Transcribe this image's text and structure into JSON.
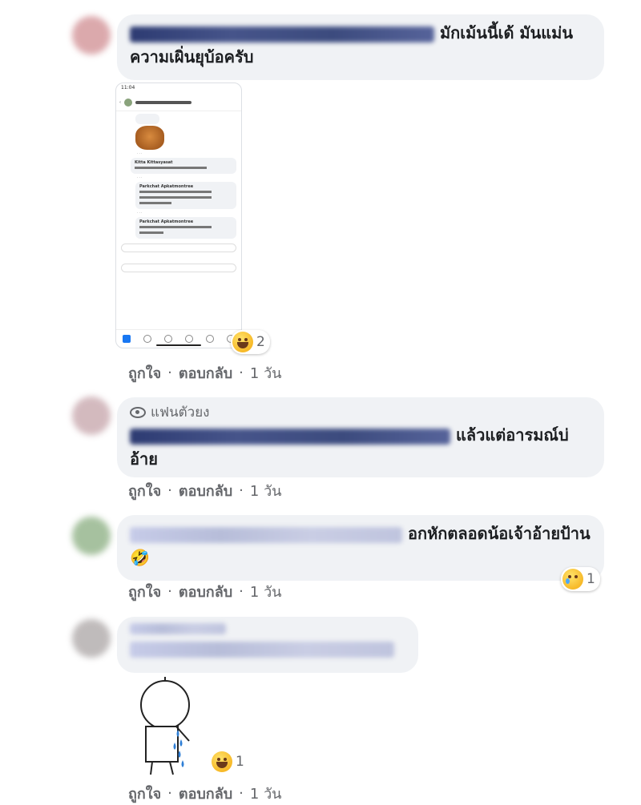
{
  "comments": [
    {
      "id": "c1",
      "suffix": "มักเม้นนี้เด้ มันแม่นความเผิ่นยุบ้อครับ",
      "meta": {
        "like": "ถูกใจ",
        "reply": "ตอบกลับ",
        "time": "1 วัน"
      },
      "reaction": {
        "emoji": "laugh",
        "count": "2"
      },
      "attachment": {
        "type": "phone-screenshot",
        "status_time": "11:04",
        "replies": [
          "Kitta Kittasyasat",
          "Parkchat Apkatmontree",
          "Parkchat Apkatmontree"
        ]
      }
    },
    {
      "id": "c2",
      "badge": "แฟนตัวยง",
      "suffix": "แล้วแต่อารมณ์บ่อ้าย",
      "meta": {
        "like": "ถูกใจ",
        "reply": "ตอบกลับ",
        "time": "1 วัน"
      }
    },
    {
      "id": "c3",
      "suffix": "อกหักตลอดน้อเจ้าอ้ายป้าน🤣",
      "meta": {
        "like": "ถูกใจ",
        "reply": "ตอบกลับ",
        "time": "1 วัน"
      },
      "reaction": {
        "emoji": "sad",
        "count": "1"
      }
    },
    {
      "id": "c4",
      "meta": {
        "like": "ถูกใจ",
        "reply": "ตอบกลับ",
        "time": "1 วัน"
      },
      "reaction": {
        "emoji": "laugh",
        "count": "1"
      },
      "attachment": {
        "type": "sticker-crying-figure"
      }
    }
  ],
  "colors": {
    "bubble": "#f0f2f5",
    "meta": "#65676b",
    "link": "#385898"
  }
}
